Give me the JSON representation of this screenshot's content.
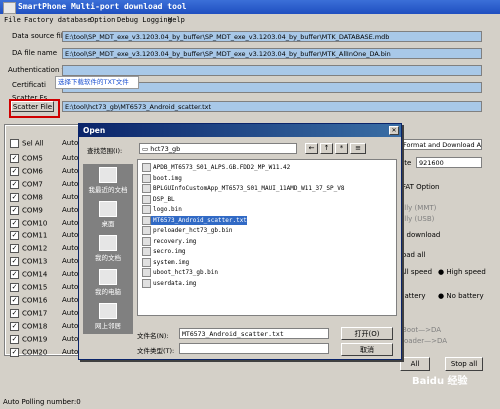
{
  "window": {
    "title": "SmartPhone Multi-port download tool"
  },
  "menu": [
    "File",
    "Factory database",
    "Option",
    "Debug Logging",
    "Help"
  ],
  "fields": {
    "data_source_label": "Data source file",
    "data_source_value": "E:\\tool\\SP_MDT_exe_v3.1203.04_by_buffer\\SP_MDT_exe_v3.1203.04_by_buffer\\MTK_DATABASE.mdb",
    "da_label": "DA file name",
    "da_value": "E:\\tool\\SP_MDT_exe_v3.1203.04_by_buffer\\SP_MDT_exe_v3.1203.04_by_buffer\\MTK_AllInOne_DA.bin",
    "auth_label": "Authentication file",
    "cert_label": "Certificati",
    "cert_note": "选择下载软件的TXT文件",
    "scatter_fs_label": "Scatter Fs",
    "scatter_button": "Scatter File",
    "scatter_value": "E:\\tool\\hct73_gb\\MT6573_Android_scatter.txt"
  },
  "ports": {
    "select_all": "Sel All",
    "auto_label": "Auto",
    "coms": [
      "COM5",
      "COM6",
      "COM7",
      "COM8",
      "COM9",
      "COM10",
      "COM11",
      "COM12",
      "COM13",
      "COM14",
      "COM15",
      "COM16",
      "COM17",
      "COM18",
      "COM19",
      "COM20"
    ]
  },
  "right_panel": {
    "mode": "Format and Download All",
    "rate_label": "ate",
    "rate": "921600",
    "fat_option": "FAT Option",
    "opt1": "n",
    "opt2": "ally (MMT)",
    "opt3": "ally (USB)",
    "download": "e download",
    "download_all": "load all",
    "all_speed": "All speed",
    "high_speed": "High speed",
    "battery": "battery",
    "no_battery": "No battery",
    "boot": "Boot—>DA",
    "loader": "loader—>DA",
    "start_all": "All",
    "stop_all": "Stop all"
  },
  "dialog": {
    "title": "Open",
    "lookin_label": "查找范围(I):",
    "lookin_value": "hct73_gb",
    "places": [
      "我最近的文档",
      "桌面",
      "我的文档",
      "我的电脑",
      "网上邻居"
    ],
    "files": [
      "APDB_MT6573_S01_ALPS.GB.FDD2_MP_W11.42",
      "boot.img",
      "BPLGUInfoCustomApp_MT6573_S01_MAUI_11AMD_W11_37_SP_V8",
      "DSP_BL",
      "logo.bin",
      "MT6573_Android_scatter.txt",
      "preloader_hct73_gb.bin",
      "recovery.img",
      "secro.img",
      "system.img",
      "uboot_hct73_gb.bin",
      "userdata.img"
    ],
    "selected_index": 5,
    "filename_label": "文件名(N):",
    "filename_value": "MT6573_Android_scatter.txt",
    "filetype_label": "文件类型(T):",
    "filetype_value": "",
    "open_button": "打开(O)",
    "cancel_button": "取消"
  },
  "status_bar": "Auto Polling number:0",
  "watermark": "Baidu 经验",
  "colors": {
    "title": "#1f4fc0",
    "field": "#a8c8e8",
    "selection": "#316ac5",
    "highlight": "#d00000"
  }
}
